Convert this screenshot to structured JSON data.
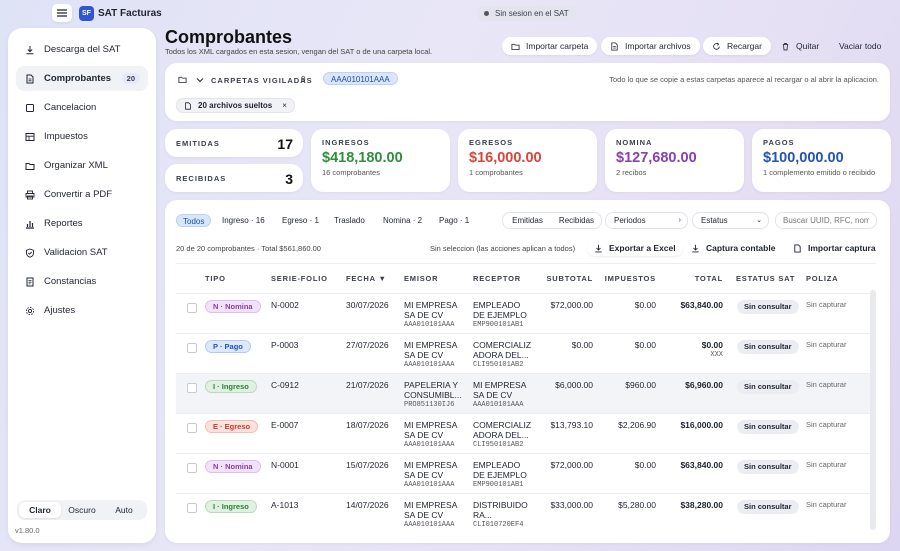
{
  "app": {
    "name": "SAT Facturas",
    "logo": "SF",
    "session": "Sin sesion en el SAT",
    "version": "v1.80.0"
  },
  "sidebar": {
    "items": [
      {
        "label": "Descarga del SAT",
        "icon": "download-icon"
      },
      {
        "label": "Comprobantes",
        "icon": "file-icon",
        "badge": "20",
        "active": true
      },
      {
        "label": "Cancelacion",
        "icon": "square-icon"
      },
      {
        "label": "Impuestos",
        "icon": "table-icon"
      },
      {
        "label": "Organizar XML",
        "icon": "folder-icon"
      },
      {
        "label": "Convertir a PDF",
        "icon": "printer-icon"
      },
      {
        "label": "Reportes",
        "icon": "bar-chart-icon"
      },
      {
        "label": "Validacion SAT",
        "icon": "shield-icon"
      },
      {
        "label": "Constancias",
        "icon": "document-icon"
      },
      {
        "label": "Ajustes",
        "icon": "settings-icon"
      }
    ],
    "theme": {
      "options": [
        "Claro",
        "Oscuro",
        "Auto"
      ],
      "selected": "Claro"
    }
  },
  "header": {
    "title": "Comprobantes",
    "subtitle": "Todos los XML cargados en esta sesion, vengan del SAT o de una carpeta local.",
    "buttons": {
      "import_folder": "Importar carpeta",
      "import_files": "Importar archivos",
      "reload": "Recargar",
      "remove": "Quitar",
      "clear": "Vaciar todo"
    }
  },
  "folders": {
    "label": "CARPETAS VIGILADAS",
    "count": "0",
    "rfc": "AAA010101AAA",
    "hint": "Todo lo que se copie a estas carpetas aparece al recargar o al abrir la aplicacion.",
    "loose": "20 archivos sueltos",
    "loose_close": "×"
  },
  "stats": {
    "emitidas": {
      "label": "EMITIDAS",
      "value": "17"
    },
    "recibidas": {
      "label": "RECIBIDAS",
      "value": "3"
    }
  },
  "kpis": [
    {
      "label": "INGRESOS",
      "value": "$418,180.00",
      "sub": "16 comprobantes",
      "color": "#2f8f3a"
    },
    {
      "label": "EGRESOS",
      "value": "$16,000.00",
      "sub": "1 comprobantes",
      "color": "#d9463a"
    },
    {
      "label": "NOMINA",
      "value": "$127,680.00",
      "sub": "2 recibos",
      "color": "#8a3fb0"
    },
    {
      "label": "PAGOS",
      "value": "$100,000.00",
      "sub": "1 complemento emitido o recibido",
      "color": "#2454b8"
    }
  ],
  "filters": {
    "tabs": [
      "Todos",
      "Ingreso · 16",
      "Egreso · 1",
      "Traslado",
      "Nomina · 2",
      "Pago · 1"
    ],
    "direction": [
      "Emitidas",
      "Recibidas"
    ],
    "periods": "Periodos",
    "status": "Estatus",
    "search_placeholder": "Buscar UUID, RFC, nom"
  },
  "summary": {
    "count": "20 de 20 comprobantes · Total $561,860.00",
    "selection": "Sin seleccion (las acciones aplican a todos)",
    "export": "Exportar a Excel",
    "capture": "Captura contable",
    "import_capture": "Importar captura"
  },
  "table": {
    "columns": [
      "TIPO",
      "SERIE-FOLIO",
      "FECHA ▼",
      "EMISOR",
      "RECEPTOR",
      "SUBTOTAL",
      "IMPUESTOS",
      "TOTAL",
      "ESTATUS SAT",
      "POLIZA"
    ],
    "rows": [
      {
        "tipo": "N · Nomina",
        "tipo_kind": "n",
        "folio": "N-0002",
        "fecha": "30/07/2026",
        "emisor": [
          "MI EMPRESA",
          "SA DE CV"
        ],
        "emisor_rfc": "AAA010101AAA",
        "receptor": [
          "EMPLEADO",
          "DE EJEMPLO"
        ],
        "receptor_rfc": "EMP900101AB1",
        "subtotal": "$72,000.00",
        "impuestos": "$0.00",
        "total": "$63,840.00",
        "total_sub": "",
        "estatus": "Sin consultar",
        "poliza": "Sin capturar"
      },
      {
        "tipo": "P · Pago",
        "tipo_kind": "p",
        "folio": "P-0003",
        "fecha": "27/07/2026",
        "emisor": [
          "MI EMPRESA",
          "SA DE CV"
        ],
        "emisor_rfc": "AAA010101AAA",
        "receptor": [
          "COMERCIALIZ",
          "ADORA DEL..."
        ],
        "receptor_rfc": "CLI950101AB2",
        "subtotal": "$0.00",
        "impuestos": "$0.00",
        "total": "$0.00",
        "total_sub": "XXX",
        "estatus": "Sin consultar",
        "poliza": "Sin capturar"
      },
      {
        "tipo": "I · Ingreso",
        "tipo_kind": "i",
        "folio": "C-0912",
        "fecha": "21/07/2026",
        "emisor": [
          "PAPELERIA Y",
          "CONSUMIBL..."
        ],
        "emisor_rfc": "PRO851130IJ6",
        "receptor": [
          "MI EMPRESA",
          "SA DE CV"
        ],
        "receptor_rfc": "AAA010101AAA",
        "subtotal": "$6,000.00",
        "impuestos": "$960.00",
        "total": "$6,960.00",
        "total_sub": "",
        "estatus": "Sin consultar",
        "poliza": "Sin capturar"
      },
      {
        "tipo": "E · Egreso",
        "tipo_kind": "e",
        "folio": "E-0007",
        "fecha": "18/07/2026",
        "emisor": [
          "MI EMPRESA",
          "SA DE CV"
        ],
        "emisor_rfc": "AAA010101AAA",
        "receptor": [
          "COMERCIALIZ",
          "ADORA DEL..."
        ],
        "receptor_rfc": "CLI950101AB2",
        "subtotal": "$13,793.10",
        "impuestos": "$2,206.90",
        "total": "$16,000.00",
        "total_sub": "",
        "estatus": "Sin consultar",
        "poliza": "Sin capturar"
      },
      {
        "tipo": "N · Nomina",
        "tipo_kind": "n",
        "folio": "N-0001",
        "fecha": "15/07/2026",
        "emisor": [
          "MI EMPRESA",
          "SA DE CV"
        ],
        "emisor_rfc": "AAA010101AAA",
        "receptor": [
          "EMPLEADO",
          "DE EJEMPLO"
        ],
        "receptor_rfc": "EMP900101AB1",
        "subtotal": "$72,000.00",
        "impuestos": "$0.00",
        "total": "$63,840.00",
        "total_sub": "",
        "estatus": "Sin consultar",
        "poliza": "Sin capturar"
      },
      {
        "tipo": "I · Ingreso",
        "tipo_kind": "i",
        "folio": "A-1013",
        "fecha": "14/07/2026",
        "emisor": [
          "MI EMPRESA",
          "SA DE CV"
        ],
        "emisor_rfc": "AAA010101AAA",
        "receptor": [
          "DISTRIBUIDO",
          "RA..."
        ],
        "receptor_rfc": "CLI010720EF4",
        "subtotal": "$33,000.00",
        "impuestos": "$5,280.00",
        "total": "$38,280.00",
        "total_sub": "",
        "estatus": "Sin consultar",
        "poliza": "Sin capturar"
      }
    ]
  },
  "colors": {
    "accent": "#3056d3",
    "nomina_bg": "#f1e2f7",
    "nomina_fg": "#8a3fb0",
    "pago_bg": "#dce8fb",
    "pago_fg": "#2454b8",
    "ingreso_bg": "#dff1e0",
    "ingreso_fg": "#2f7d36",
    "egreso_bg": "#fbe1dc",
    "egreso_fg": "#c53b2d"
  }
}
